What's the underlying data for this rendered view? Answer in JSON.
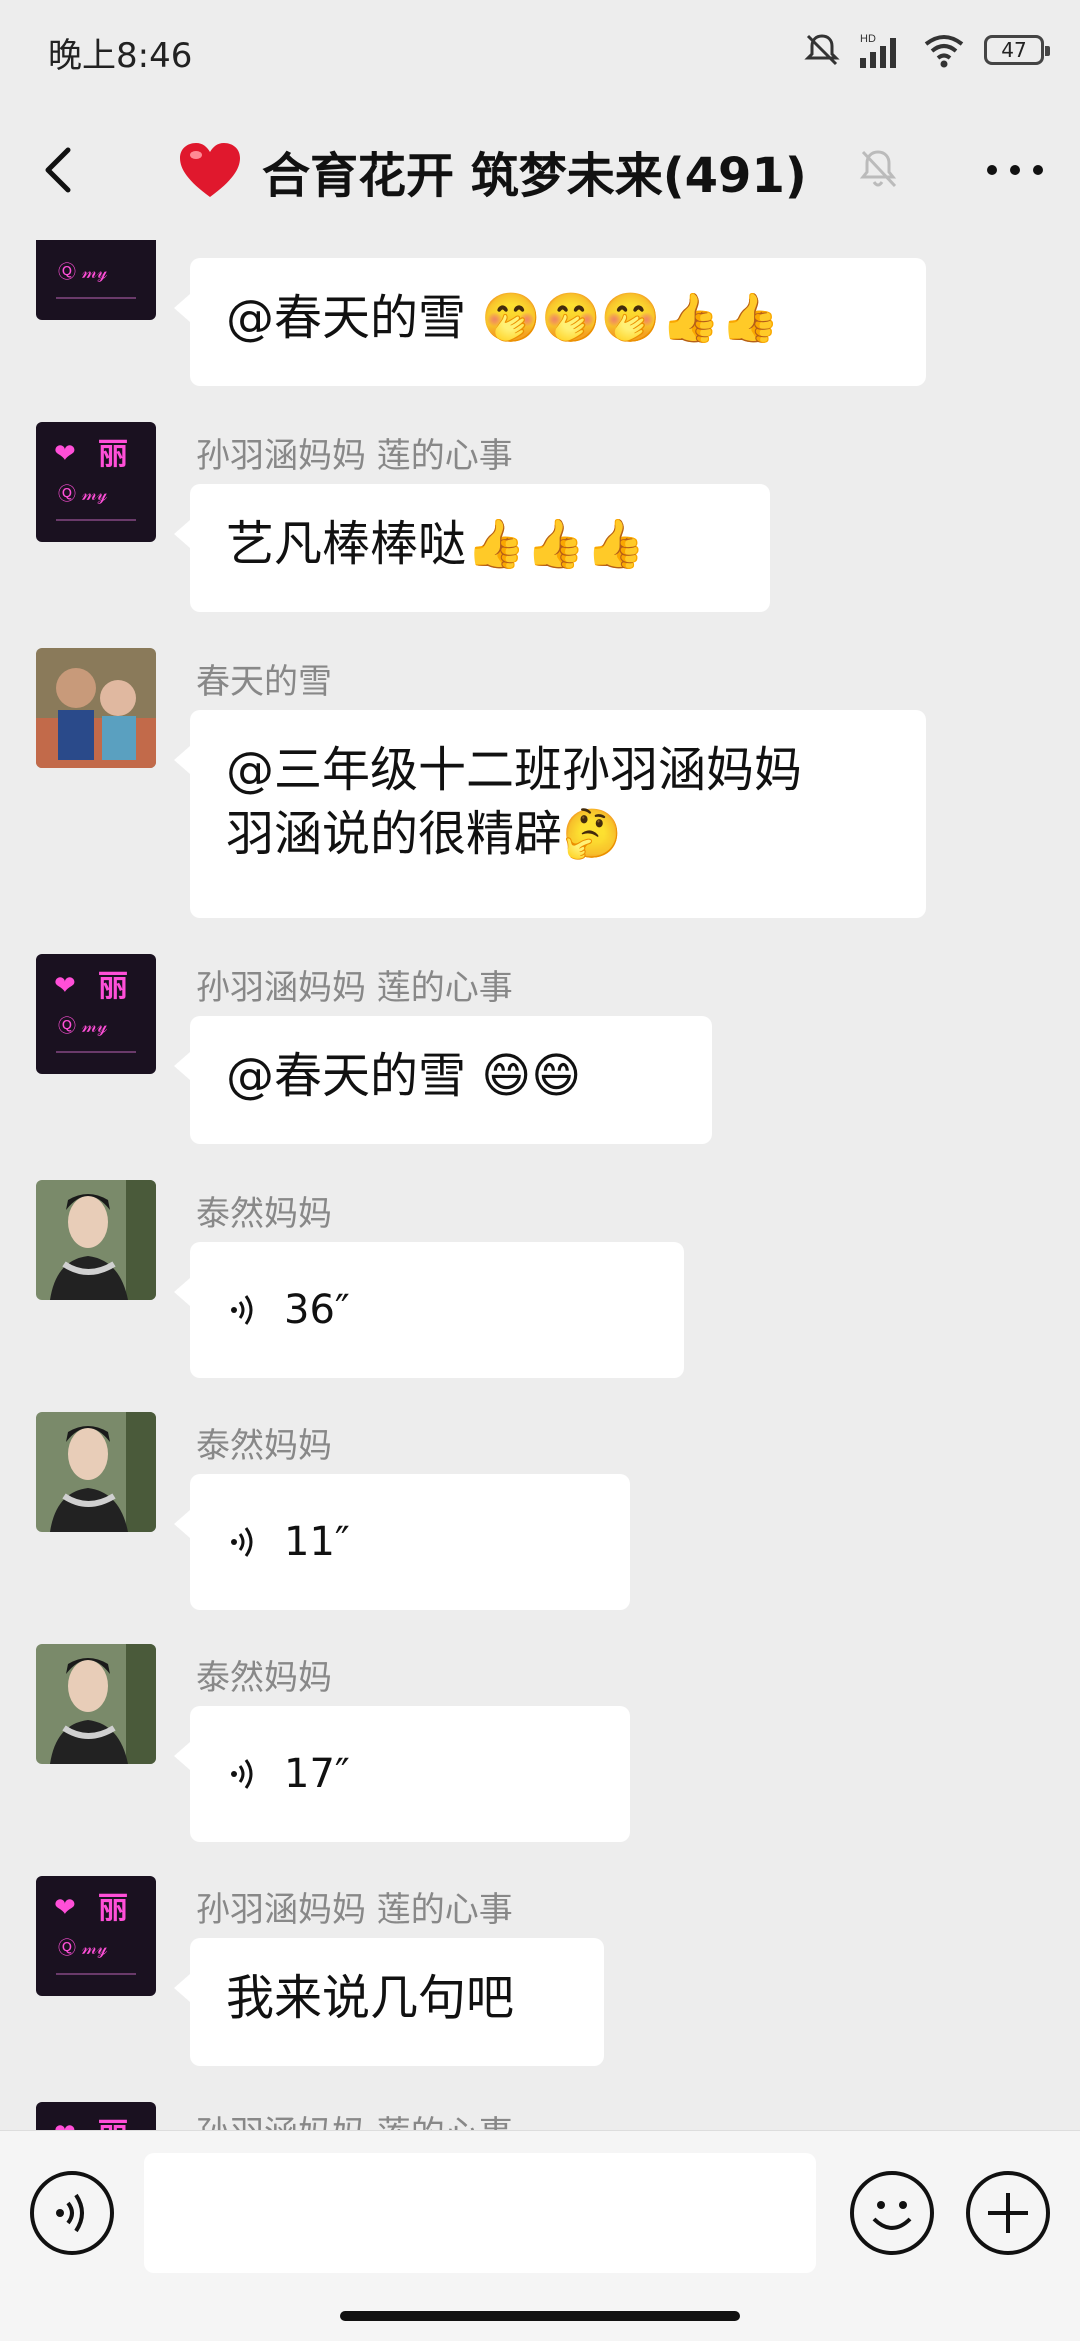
{
  "status_bar": {
    "time": "晚上8:46",
    "battery": "47",
    "network": "HD"
  },
  "header": {
    "title": "合育花开 筑梦未来(491)",
    "title_heart": "❤️"
  },
  "messages": [
    {
      "sender": "",
      "text": "@春天的雪 🤭🤭🤭👍👍",
      "avatar": "li-neon"
    },
    {
      "sender": "孙羽涵妈妈  莲的心事",
      "text": "艺凡棒棒哒👍👍👍",
      "avatar": "li-neon"
    },
    {
      "sender": "春天的雪",
      "text_line1": "@三年级十二班孙羽涵妈妈",
      "text_line2": " 羽涵说的很精辟🤔",
      "avatar": "kids-photo"
    },
    {
      "sender": "孙羽涵妈妈  莲的心事",
      "text": "@春天的雪 😄😄",
      "avatar": "li-neon"
    },
    {
      "sender": "泰然妈妈",
      "voice": "36″",
      "avatar": "woman-photo"
    },
    {
      "sender": "泰然妈妈",
      "voice": "11″",
      "avatar": "woman-photo"
    },
    {
      "sender": "泰然妈妈",
      "voice": "17″",
      "avatar": "woman-photo"
    },
    {
      "sender": "孙羽涵妈妈  莲的心事",
      "text": "我来说几句吧",
      "avatar": "li-neon"
    },
    {
      "sender": "孙羽涵妈妈  莲的心事",
      "text": "",
      "avatar": "li-neon"
    }
  ],
  "composer": {
    "placeholder": ""
  },
  "colors": {
    "background": "#ededed",
    "bubble": "#ffffff",
    "neon_pink": "#ff4fd8",
    "avatar_dark": "#1a1120"
  }
}
